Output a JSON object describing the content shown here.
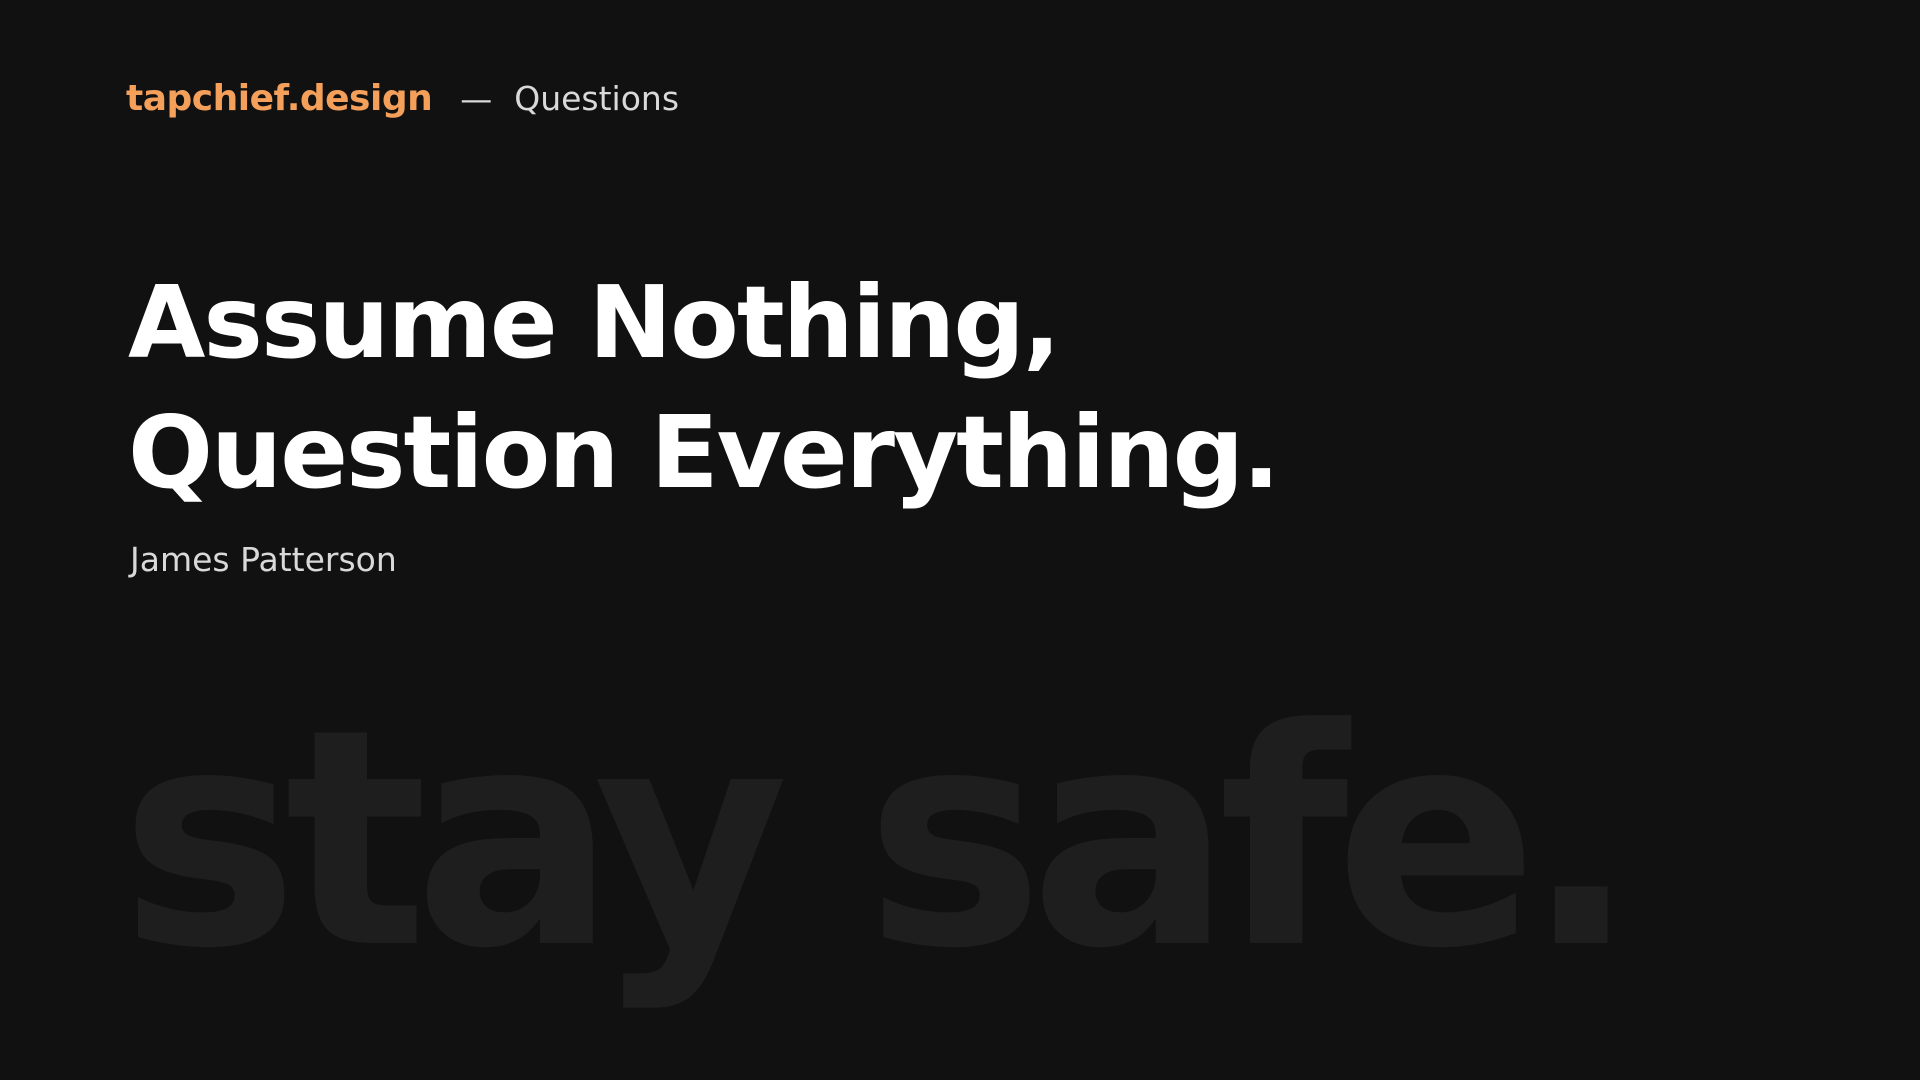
{
  "header": {
    "brand": "tapchief.design",
    "separator": "—",
    "section": "Questions"
  },
  "quote": {
    "line1": "Assume Nothing,",
    "line2": "Question Everything.",
    "author": "James Patterson"
  },
  "background_text": "stay safe.",
  "colors": {
    "background": "#111111",
    "brand": "#f4a05a",
    "headline": "#ffffff",
    "muted": "#d9d9d9",
    "watermark": "#1e1e1e"
  }
}
